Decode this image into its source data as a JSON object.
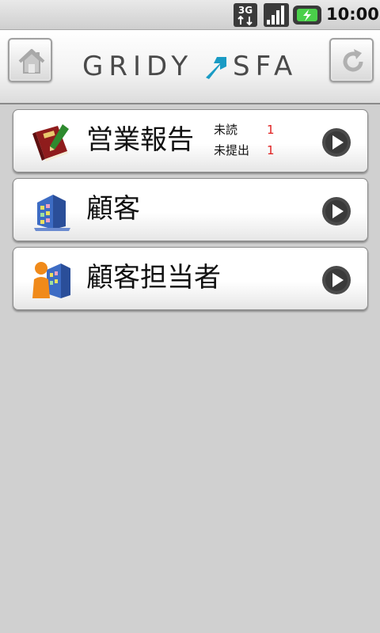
{
  "status_bar": {
    "network": "3G",
    "time": "10:00",
    "icons": [
      "3g-data-icon",
      "signal-strength-icon",
      "battery-charging-icon"
    ]
  },
  "header": {
    "logo_left": "GRIDY",
    "logo_right": "SFA",
    "home_icon": "home-icon",
    "refresh_icon": "refresh-icon"
  },
  "menu": {
    "items": [
      {
        "label": "営業報告",
        "icon": "diary-book-icon",
        "badges": [
          {
            "label": "未読",
            "count": "1"
          },
          {
            "label": "未提出",
            "count": "1"
          }
        ]
      },
      {
        "label": "顧客",
        "icon": "building-icon"
      },
      {
        "label": "顧客担当者",
        "icon": "person-building-icon"
      }
    ]
  },
  "colors": {
    "background": "#d0d0d0",
    "badge_count": "#e02020",
    "logo_text": "#4a4a4a",
    "logo_arrow": "#1a9bc4"
  }
}
